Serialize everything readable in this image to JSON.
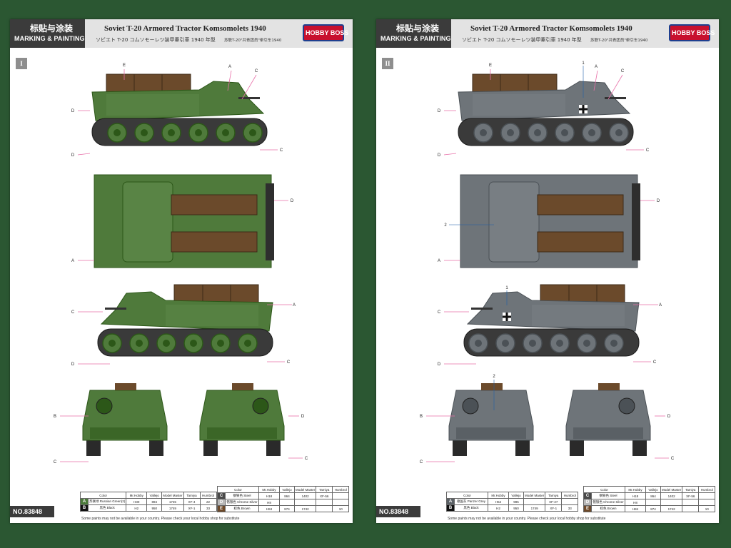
{
  "header": {
    "cn_title": "标贴与涂装",
    "marking_painting": "MARKING & PAINTING",
    "title": "Soviet T-20 Armored Tractor Komsomolets 1940",
    "subtitle_jp": "ソビエト T-20 コムソモーレツ装甲牽引車 1940 年型",
    "subtitle_cn": "苏联T-20\"共青团员\"牵引车1940",
    "logo_text": "HOBBY BOSS"
  },
  "sheets": [
    {
      "section": "I",
      "scheme_color": "#4f7a3b"
    },
    {
      "section": "II",
      "scheme_color": "#6e7479"
    }
  ],
  "footer": {
    "product_no": "NO.83848",
    "note": "Some paints may not be available in your country. Please check your local hobby shop for substitute"
  },
  "paint_table": {
    "headers": [
      "Color",
      "Mr.Hobby",
      "Vallejo",
      "Model Master",
      "Tamiya",
      "Humbrol"
    ],
    "left_rows": [
      {
        "code": "A",
        "color": "苏联绿 Russian Green(2)",
        "mrhobby": "H30",
        "vallejo": "894",
        "model_master": "1745",
        "tamiya": "XF-4",
        "humbrol": "22",
        "swatch": "#4b7a3a"
      },
      {
        "code": "B",
        "color": "黑色 Black",
        "mrhobby": "H2",
        "vallejo": "950",
        "model_master": "1749",
        "tamiya": "XF-1",
        "humbrol": "33",
        "swatch": "#111111"
      }
    ],
    "right_rows": [
      {
        "code": "C",
        "color": "钢铁色 Steel",
        "mrhobby": "H18",
        "vallejo": "864",
        "model_master": "1402",
        "tamiya": "XF-56",
        "humbrol": "",
        "swatch": "#4a4a4a"
      },
      {
        "code": "D",
        "color": "铬银色 Chrome Silver",
        "mrhobby": "H8",
        "vallejo": "",
        "model_master": "",
        "tamiya": "",
        "humbrol": "",
        "swatch": "#b8b8b8"
      },
      {
        "code": "E",
        "color": "棕色 Brown",
        "mrhobby": "H84",
        "vallejo": "874",
        "model_master": "1742",
        "tamiya": "",
        "humbrol": "10",
        "swatch": "#6e4a2a"
      }
    ],
    "right_rows_alt": [
      {
        "code": "A",
        "color": "德国灰 Panzer Grey",
        "mrhobby": "H54",
        "vallejo": "995",
        "model_master": "",
        "tamiya": "XF-27",
        "humbrol": "",
        "swatch": "#5b6166"
      }
    ]
  },
  "callouts": [
    "A",
    "B",
    "C",
    "D",
    "E",
    "1",
    "2"
  ]
}
